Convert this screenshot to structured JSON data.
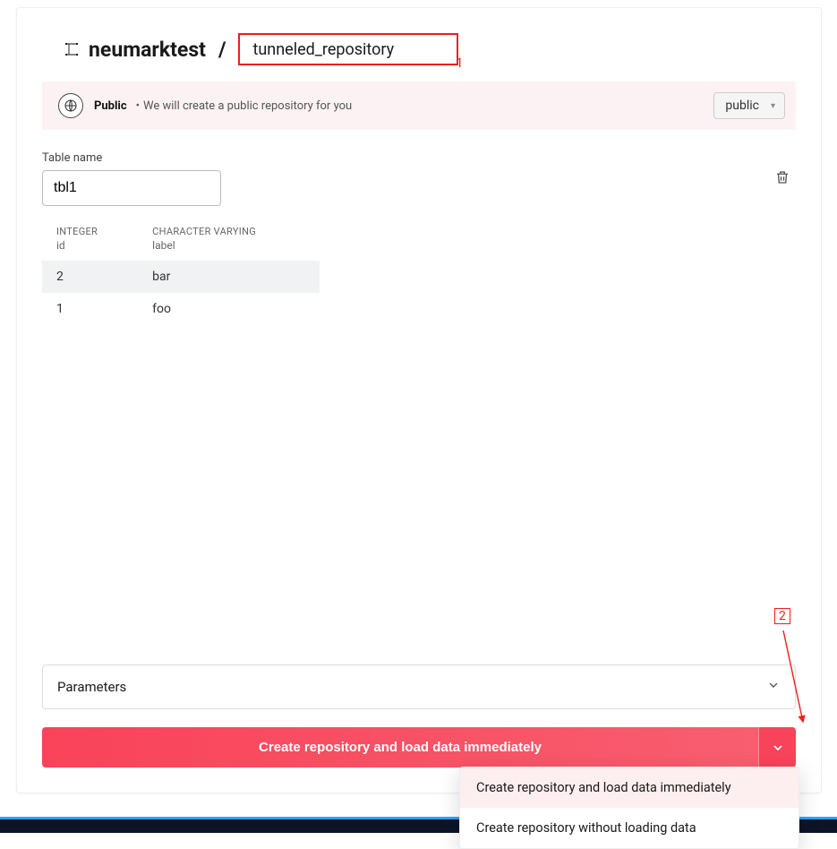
{
  "header": {
    "namespace": "neumarktest",
    "slash": "/",
    "repo_name": "tunneled_repository",
    "annotation1": "1",
    "annotation2": "2"
  },
  "visibility": {
    "label": "Public",
    "desc": "We will create a public repository for you",
    "selected": "public"
  },
  "table": {
    "name_label": "Table name",
    "name_value": "tbl1",
    "columns": [
      {
        "type": "INTEGER",
        "name": "id"
      },
      {
        "type": "CHARACTER VARYING",
        "name": "label"
      }
    ],
    "rows": [
      {
        "id": "2",
        "label": "bar"
      },
      {
        "id": "1",
        "label": "foo"
      }
    ]
  },
  "parameters": {
    "label": "Parameters"
  },
  "action": {
    "primary_label": "Create repository and load data immediately",
    "menu": [
      "Create repository and load data immediately",
      "Create repository without loading data"
    ]
  }
}
